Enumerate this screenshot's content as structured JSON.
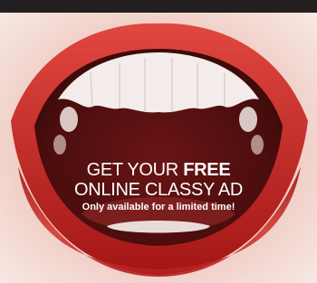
{
  "ad": {
    "headline_prefix": "GET YOUR ",
    "headline_emphasis": "FREE",
    "headline_line2": "ONLINE CLASSY AD",
    "subline": "Only available for a limited time!"
  },
  "image": {
    "subject": "open-mouth-illustration"
  },
  "colors": {
    "top_bar": "#231f20",
    "lip_red": "#c81d1d",
    "mouth_interior": "#5a1111",
    "skin": "#f2d6d0",
    "text": "#ffffff"
  }
}
